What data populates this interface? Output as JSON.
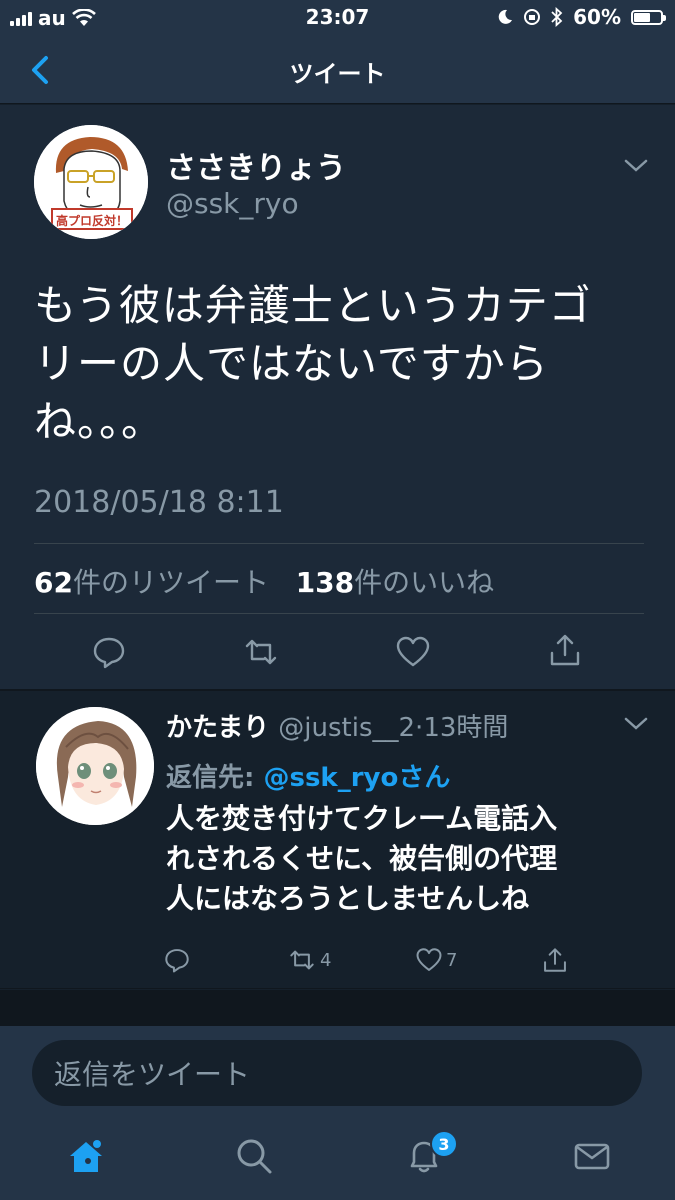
{
  "status_bar": {
    "carrier": "au",
    "time": "23:07",
    "battery_percent": "60%",
    "battery_level": 0.6
  },
  "nav": {
    "title": "ツイート",
    "back_icon": "chevron-left-icon"
  },
  "tweet": {
    "display_name": "ささきりょう",
    "handle": "@ssk_ryo",
    "avatar_badge_text": "高プロ反対！",
    "text_lines": [
      "もう彼は弁護士というカテゴ",
      "リーの人ではないですから",
      "ね。。。"
    ],
    "timestamp": "2018/05/18 8:11",
    "retweet_count": "62",
    "retweet_label": "件のリツイート",
    "like_count": "138",
    "like_label": "件のいいね"
  },
  "reply": {
    "display_name": "かたまり",
    "handle_meta": "@justis__2·13時間",
    "reply_to_label": "返信先:",
    "reply_to_handle": "@ssk_ryoさん",
    "text_lines": [
      "人を焚き付けてクレーム電話入",
      "れされるくせに、被告側の代理",
      "人にはなろうとしませんしね"
    ],
    "retweet_count": "4",
    "like_count": "7"
  },
  "composer": {
    "placeholder": "返信をツイート"
  },
  "tabbar": {
    "notification_badge": "3"
  },
  "colors": {
    "background": "#15202b",
    "card": "#1c2938",
    "bar": "#243447",
    "accent": "#1da1f2",
    "secondary_text": "#8899a6"
  }
}
